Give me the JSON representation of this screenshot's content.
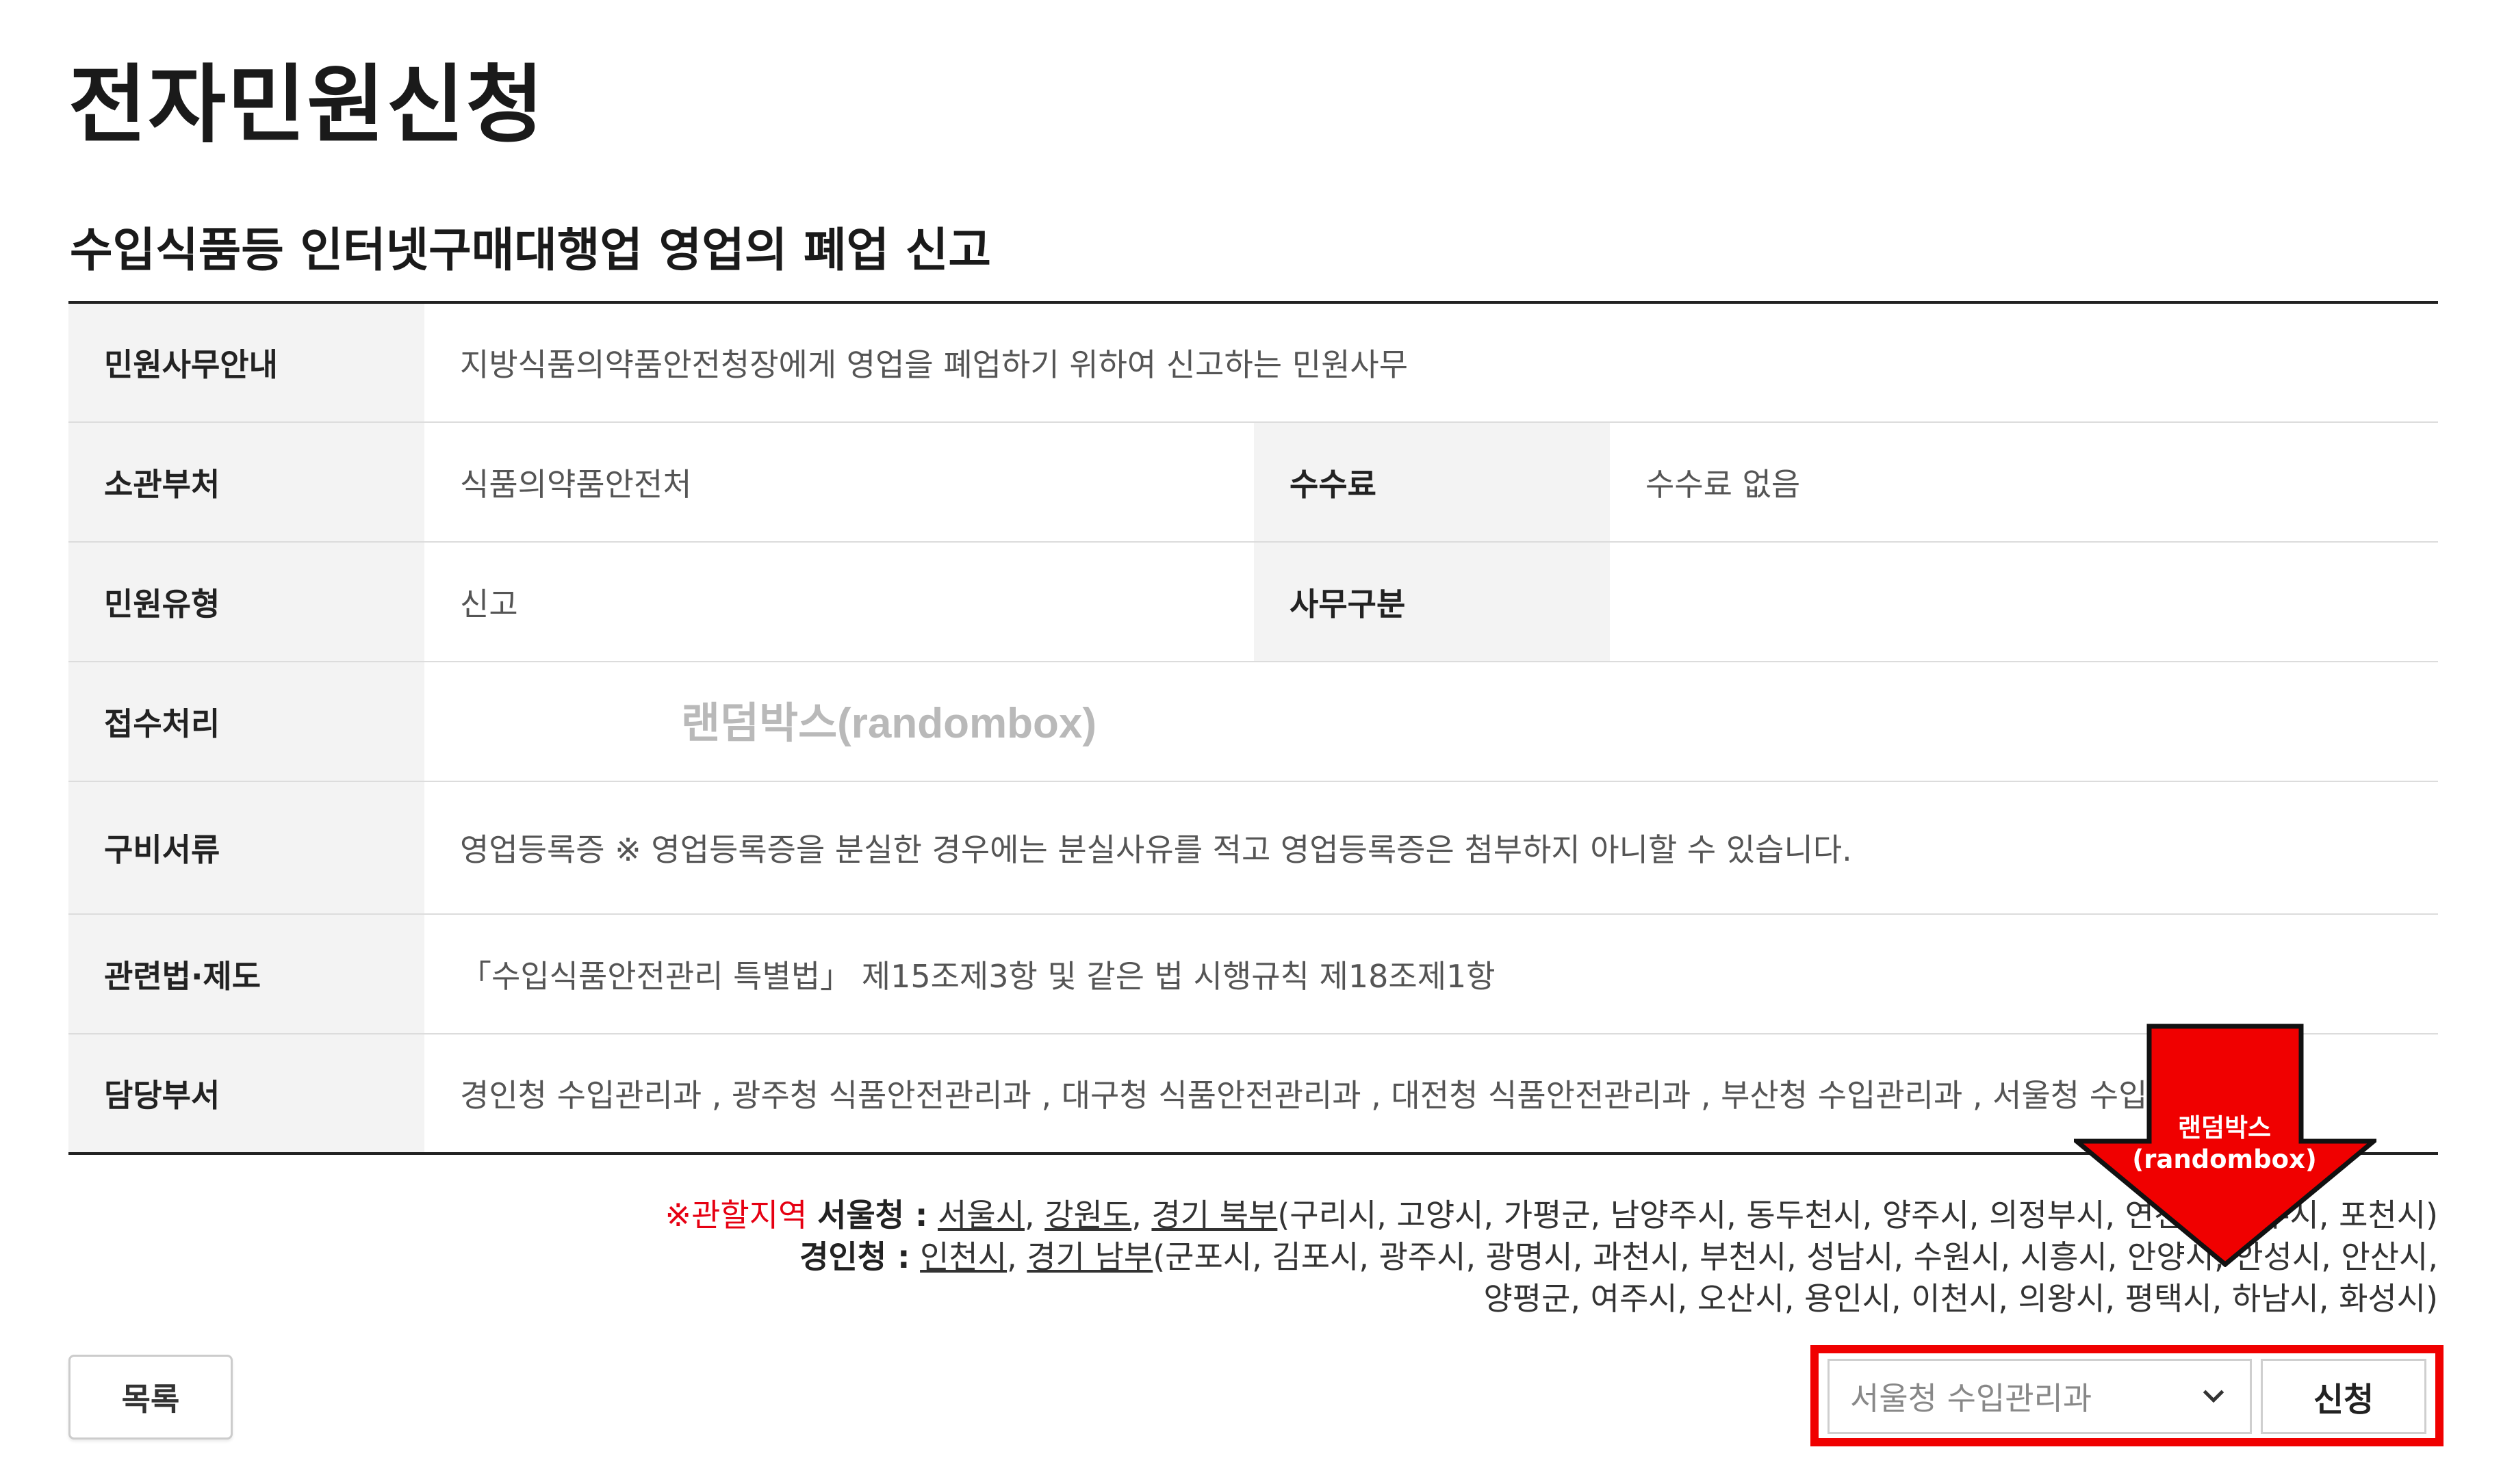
{
  "page": {
    "title": "전자민원신청",
    "subtitle": "수입식품등 인터넷구매대행업 영업의 폐업 신고"
  },
  "info": {
    "guide_label": "민원사무안내",
    "guide_value": "지방식품의약품안전청장에게 영업을 폐업하기 위하여 신고하는 민원사무",
    "dept_label": "소관부처",
    "dept_value": "식품의약품안전처",
    "fee_label": "수수료",
    "fee_value": "수수료 없음",
    "type_label": "민원유형",
    "type_value": "신고",
    "category_label": "사무구분",
    "category_value": "",
    "processing_label": "접수처리",
    "processing_value": "",
    "documents_label": "구비서류",
    "documents_value": "영업등록증 ※ 영업등록증을 분실한 경우에는 분실사유를 적고 영업등록증은 첨부하지 아니할 수 있습니다.",
    "law_label": "관련법·제도",
    "law_value": "「수입식품안전관리 특별법」 제15조제3항 및 같은 법 시행규칙 제18조제1항",
    "office_label": "담당부서",
    "office_value": "경인청 수입관리과 , 광주청 식품안전관리과 , 대구청 식품안전관리과 , 대전청 식품안전관리과 , 부산청 수입관리과 , 서울청 수입관리과"
  },
  "watermark": "랜덤박스(randombox)",
  "region": {
    "label": "※관할지역",
    "seoul_office": "서울청 :",
    "seoul_a": "서울시",
    "sep1": ", ",
    "seoul_b": "강원도",
    "sep2": ", ",
    "seoul_c": "경기 북부",
    "seoul_rest": "(구리시, 고양시, 가평군, 남양주시, 동두천시, 양주시, 의정부시, 연천군, 파주시, 포천시)",
    "gyeongin_office": "경인청 :",
    "gyeongin_a": "인천시",
    "sep3": ", ",
    "gyeongin_b": "경기 남부",
    "gyeongin_rest1": "(군포시, 김포시, 광주시, 광명시, 과천시, 부천시, 성남시, 수원시, 시흥시, 안양시, 안성시, 안산시,",
    "gyeongin_rest2": "양평군, 여주시, 오산시, 용인시, 이천시, 의왕시, 평택시, 하남시, 화성시)"
  },
  "actions": {
    "list_label": "목록",
    "select_value": "서울청 수입관리과",
    "apply_label": "신청"
  },
  "callout": {
    "line1": "랜덤박스",
    "line2": "(randombox)",
    "color": "#f00000"
  }
}
